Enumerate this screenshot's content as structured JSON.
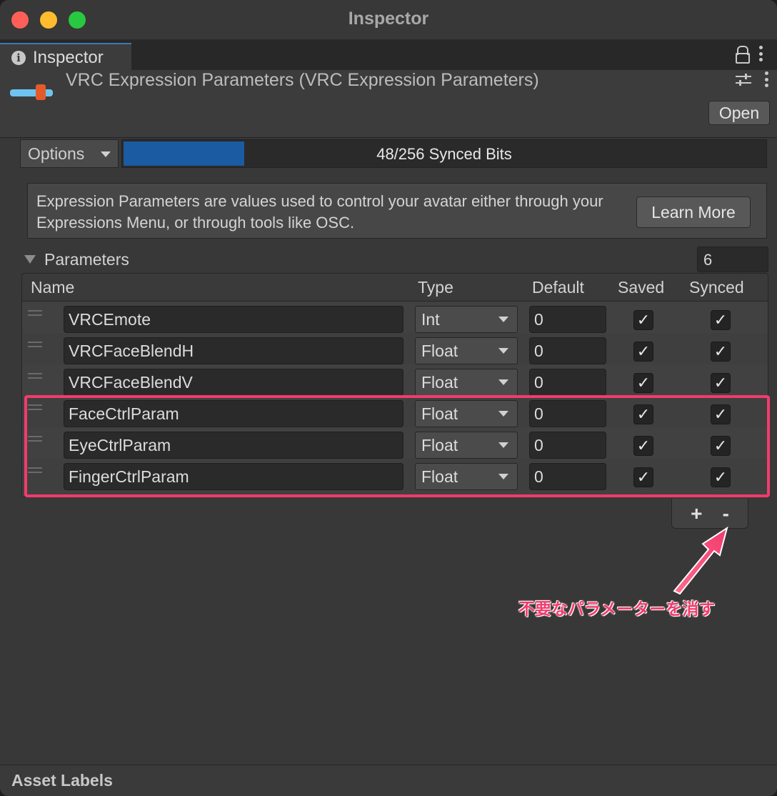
{
  "window": {
    "title": "Inspector"
  },
  "tab": {
    "label": "Inspector",
    "icon": "info-icon"
  },
  "asset": {
    "title": "VRC Expression Parameters (VRC Expression Parameters)",
    "open_label": "Open"
  },
  "options": {
    "label": "Options",
    "synced_bits_text": "48/256 Synced Bits",
    "synced_bits_fraction": 0.1875
  },
  "help": {
    "text": "Expression Parameters are values used to control your avatar either through your Expressions Menu, or through tools like OSC.",
    "learn_more_label": "Learn More"
  },
  "parameters": {
    "label": "Parameters",
    "count": "6",
    "columns": {
      "name": "Name",
      "type": "Type",
      "default": "Default",
      "saved": "Saved",
      "synced": "Synced"
    },
    "rows": [
      {
        "name": "VRCEmote",
        "type": "Int",
        "default": "0",
        "saved": true,
        "synced": true
      },
      {
        "name": "VRCFaceBlendH",
        "type": "Float",
        "default": "0",
        "saved": true,
        "synced": true
      },
      {
        "name": "VRCFaceBlendV",
        "type": "Float",
        "default": "0",
        "saved": true,
        "synced": true
      },
      {
        "name": "FaceCtrlParam",
        "type": "Float",
        "default": "0",
        "saved": true,
        "synced": true
      },
      {
        "name": "EyeCtrlParam",
        "type": "Float",
        "default": "0",
        "saved": true,
        "synced": true
      },
      {
        "name": "FingerCtrlParam",
        "type": "Float",
        "default": "0",
        "saved": true,
        "synced": true
      }
    ],
    "add_label": "+",
    "remove_label": "-"
  },
  "annotation": {
    "text": "不要なパラメーターを消す",
    "color": "#f23b6d"
  },
  "footer": {
    "label": "Asset Labels"
  },
  "colors": {
    "accent": "#1b5ba1",
    "highlight": "#f23b6d",
    "background": "#383838"
  }
}
